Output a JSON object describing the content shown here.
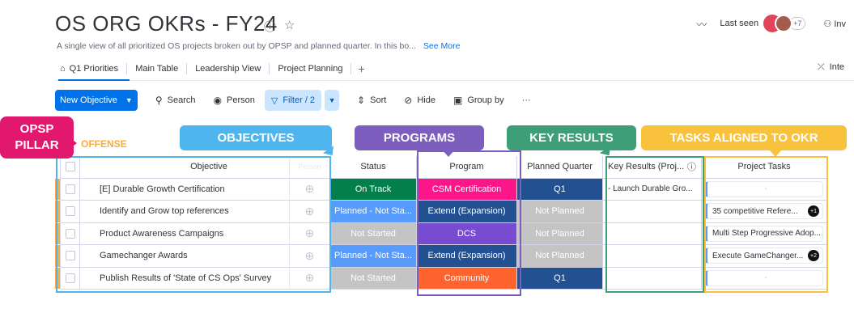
{
  "board": {
    "title": "OS ORG OKRs - FY24",
    "description": "A single view of all prioritized OS projects broken out by OPSP and planned quarter. In this bo...",
    "see_more": "See More"
  },
  "header_right": {
    "last_seen_label": "Last seen",
    "avatar_count": "+7",
    "invite_label": "Inv"
  },
  "tabs": [
    {
      "label": "Q1 Priorities"
    },
    {
      "label": "Main Table"
    },
    {
      "label": "Leadership View"
    },
    {
      "label": "Project Planning"
    }
  ],
  "integrate_label": "Inte",
  "toolbar": {
    "new_label": "New Objective",
    "search_label": "Search",
    "person_label": "Person",
    "filter_label": "Filter / 2",
    "sort_label": "Sort",
    "hide_label": "Hide",
    "group_label": "Group by",
    "more_label": "···"
  },
  "callouts": {
    "opsp": "OPSP PILLAR",
    "objectives": "OBJECTIVES",
    "programs": "PROGRAMS",
    "key_results": "KEY RESULTS",
    "tasks": "TASKS ALIGNED TO OKR"
  },
  "group": {
    "title": "OFFENSE",
    "color": "#fdab3d"
  },
  "columns": {
    "objective": "Objective",
    "hidden": "Person",
    "status": "Status",
    "program": "Program",
    "planned_quarter": "Planned Quarter",
    "key_results": "Key Results (Proj...",
    "project_tasks": "Project Tasks"
  },
  "rows": [
    {
      "objective": "[E] Durable Growth Certification",
      "status": "On Track",
      "status_color": "#037f4c",
      "program": "CSM Certification",
      "program_color": "#ff158a",
      "pq": "Q1",
      "pq_color": "#225091",
      "kr": "- Launch Durable Gro...",
      "task": "-",
      "task_badge": ""
    },
    {
      "objective": "Identify and Grow top references",
      "status": "Planned - Not Sta...",
      "status_color": "#579bfc",
      "program": "Extend (Expansion)",
      "program_color": "#225091",
      "pq": "Not Planned",
      "pq_color": "#c4c4c4",
      "kr": "",
      "task": "35 competitive Refere...",
      "task_badge": "+1"
    },
    {
      "objective": "Product Awareness Campaigns",
      "status": "Not Started",
      "status_color": "#c4c4c4",
      "program": "DCS",
      "program_color": "#784bd1",
      "pq": "Not Planned",
      "pq_color": "#c4c4c4",
      "kr": "",
      "task": "Multi Step Progressive Adop...",
      "task_badge": ""
    },
    {
      "objective": "Gamechanger Awards",
      "status": "Planned - Not Sta...",
      "status_color": "#579bfc",
      "program": "Extend (Expansion)",
      "program_color": "#225091",
      "pq": "Not Planned",
      "pq_color": "#c4c4c4",
      "kr": "",
      "task": "Execute GameChanger...",
      "task_badge": "+2"
    },
    {
      "objective": "Publish Results of 'State of CS Ops' Survey",
      "status": "Not Started",
      "status_color": "#c4c4c4",
      "program": "Community",
      "program_color": "#ff642e",
      "pq": "Q1",
      "pq_color": "#225091",
      "kr": "",
      "task": "-",
      "task_badge": ""
    }
  ]
}
